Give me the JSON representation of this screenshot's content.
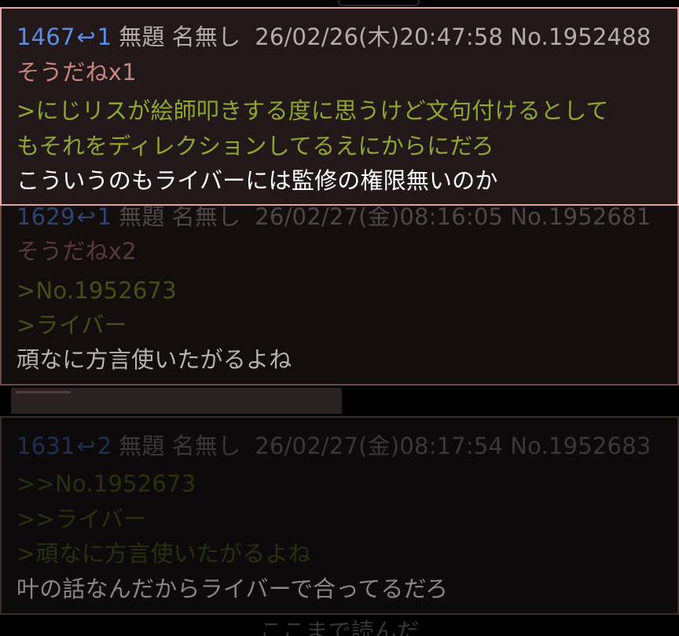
{
  "posts": [
    {
      "index": "1467",
      "reply_count": "1",
      "subject": "無題",
      "name": "名無し",
      "datetime": "26/02/26(木)20:47:58",
      "post_no": "No.1952488",
      "sodane": "そうだねx1",
      "quotes": [
        ">にじリスが絵師叩きする度に思うけど文句付けるとして",
        "もそれをディレクションしてるえにからにだろ"
      ],
      "body": "こういうのもライバーには監修の権限無いのか"
    },
    {
      "index": "1629",
      "reply_count": "1",
      "subject": "無題",
      "name": "名無し",
      "datetime": "26/02/27(金)08:16:05",
      "post_no": "No.1952681",
      "sodane": "そうだねx2",
      "quotes": [
        ">No.1952673",
        ">ライバー"
      ],
      "body": "頑なに方言使いたがるよね"
    },
    {
      "index": "1631",
      "reply_count": "2",
      "subject": "無題",
      "name": "名無し",
      "datetime": "26/02/27(金)08:17:54",
      "post_no": "No.1952683",
      "quotes": [
        ">>No.1952673",
        ">>ライバー",
        ">頑なに方言使いたがるよね"
      ],
      "body": "叶の話なんだからライバーで合ってるだろ"
    }
  ],
  "footer": "ここまで読んだ",
  "icons": {
    "reply": "reply-arrow-icon"
  },
  "colors": {
    "index_post1": "#5b8de6",
    "quote_post1": "#8fa631",
    "sodane_post1": "#c9857d",
    "body_post1": "#ffffff",
    "header_post1": "#b3acab",
    "border_post1": "#e7a5a0"
  }
}
